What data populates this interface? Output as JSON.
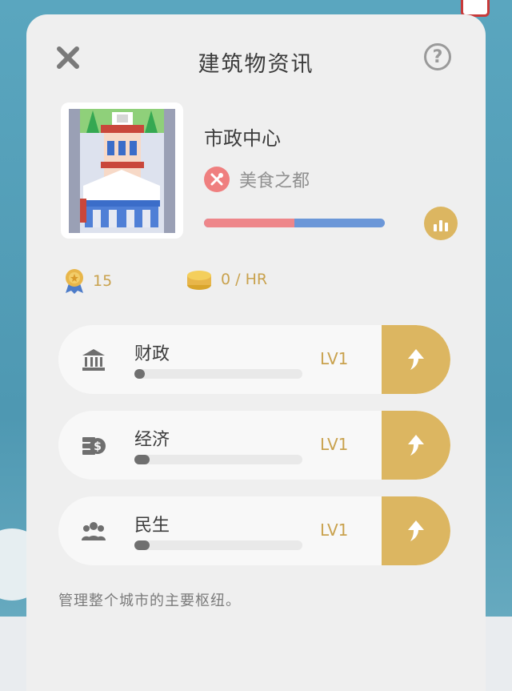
{
  "header": {
    "title": "建筑物资讯"
  },
  "building": {
    "name": "市政中心",
    "category": "美食之都",
    "balance_ratio": 0.5
  },
  "resources": {
    "medal_value": "15",
    "coin_rate": "0 / HR"
  },
  "attributes": [
    {
      "name": "财政",
      "level": "LV1",
      "progress": 0.06,
      "icon": "bank-icon"
    },
    {
      "name": "经济",
      "level": "LV1",
      "progress": 0.09,
      "icon": "money-icon"
    },
    {
      "name": "民生",
      "level": "LV1",
      "progress": 0.09,
      "icon": "people-icon"
    }
  ],
  "description": "管理整个城市的主要枢纽。",
  "colors": {
    "gold": "#dcb661",
    "red_bar": "#ee868a",
    "blue_bar": "#6b97d8",
    "panel": "#efefef"
  }
}
